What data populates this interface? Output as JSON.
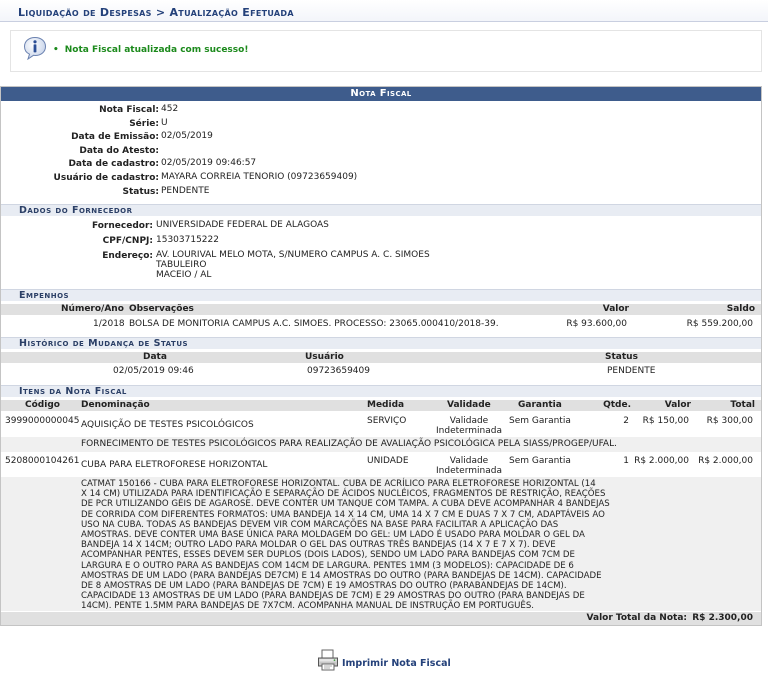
{
  "breadcrumb": "Liquidação de Despesas > Atualização Efetuada",
  "message": "Nota Fiscal atualizada com sucesso!",
  "panel_title": "Nota Fiscal",
  "nota": {
    "fields": [
      {
        "label": "Nota Fiscal:",
        "value": "452"
      },
      {
        "label": "Série:",
        "value": "U"
      },
      {
        "label": "Data de Emissão:",
        "value": "02/05/2019"
      },
      {
        "label": "Data do Atesto:",
        "value": ""
      },
      {
        "label": "Data de cadastro:",
        "value": "02/05/2019 09:46:57"
      },
      {
        "label": "Usuário de cadastro:",
        "value": "MAYARA CORREIA TENORIO (09723659409)"
      },
      {
        "label": "Status:",
        "value": "PENDENTE"
      }
    ]
  },
  "fornecedor": {
    "section": "Dados do Fornecedor",
    "fornecedor_label": "Fornecedor:",
    "fornecedor_value": "UNIVERSIDADE FEDERAL DE ALAGOAS",
    "cpf_label": "CPF/CNPJ:",
    "cpf_value": "15303715222",
    "endereco_label": "Endereço:",
    "endereco_lines": [
      "AV. LOURIVAL MELO MOTA, S/NUMERO CAMPUS A. C. SIMOES",
      "TABULEIRO",
      "MACEIO / AL"
    ]
  },
  "empenhos": {
    "section": "Empenhos",
    "headers": {
      "numero": "Número/Ano",
      "obs": "Observações",
      "valor": "Valor",
      "saldo": "Saldo"
    },
    "rows": [
      {
        "numero": "1/2018",
        "obs": "BOLSA DE MONITORIA CAMPUS A.C. SIMOES. PROCESSO: 23065.000410/2018-39.",
        "valor": "R$ 93.600,00",
        "saldo": "R$ 559.200,00"
      }
    ]
  },
  "historico": {
    "section": "Histórico de Mudança de Status",
    "headers": {
      "data": "Data",
      "usuario": "Usuário",
      "status": "Status"
    },
    "rows": [
      {
        "data": "02/05/2019 09:46",
        "usuario": "09723659409",
        "status": "PENDENTE"
      }
    ]
  },
  "itens": {
    "section": "Itens da Nota Fiscal",
    "headers": {
      "codigo": "Código",
      "denominacao": "Denominação",
      "medida": "Medida",
      "validade": "Validade",
      "garantia": "Garantia",
      "qtde": "Qtde.",
      "valor": "Valor",
      "total": "Total"
    },
    "rows": [
      {
        "codigo": "3999000000045",
        "denominacao": "AQUISIÇÃO DE TESTES PSICOLÓGICOS",
        "medida": "SERVIÇO",
        "validade": [
          "Validade",
          "Indeterminada"
        ],
        "garantia": "Sem Garantia",
        "qtde": "2",
        "valor": "R$ 150,00",
        "total": "R$ 300,00",
        "descricao": "FORNECIMENTO DE TESTES PSICOLÓGICOS PARA REALIZAÇÃO DE AVALIAÇÃO PSICOLÓGICA PELA SIASS/PROGEP/UFAL."
      },
      {
        "codigo": "5208000104261",
        "denominacao": "CUBA PARA ELETROFORESE HORIZONTAL",
        "medida": "UNIDADE",
        "validade": [
          "Validade",
          "Indeterminada"
        ],
        "garantia": "Sem Garantia",
        "qtde": "1",
        "valor": "R$ 2.000,00",
        "total": "R$ 2.000,00",
        "descricao_lines": [
          "CATMAT 150166 - CUBA PARA ELETROFORESE HORIZONTAL. CUBA DE ACRÍLICO PARA ELETROFORESE HORIZONTAL (14",
          "X 14 CM) UTILIZADA PARA IDENTIFICAÇÃO E SEPARAÇÃO DE ÁCIDOS NUCLÉICOS, FRAGMENTOS DE RESTRIÇÃO, REAÇÕES",
          "DE PCR UTILIZANDO GÉIS DE AGAROSE. DEVE CONTER UM TANQUE COM TAMPA. A CUBA DEVE ACOMPANHAR 4 BANDEJAS",
          "DE CORRIDA COM DIFERENTES FORMATOS: UMA BANDEJA 14 X 14 CM, UMA 14 X 7 CM E DUAS 7 X 7 CM, ADAPTÁVEIS AO",
          "USO NA CUBA. TODAS AS BANDEJAS DEVEM VIR COM MARCAÇÕES NA BASE PARA FACILITAR A APLICAÇÃO DAS",
          "AMOSTRAS. DEVE CONTER UMA BASE ÚNICA PARA MOLDAGEM DO GEL: UM LADO É USADO PARA MOLDAR O GEL DA",
          "BANDEJA 14 X 14CM; OUTRO LADO PARA MOLDAR O GEL DAS OUTRAS TRÊS BANDEJAS (14 X 7 E 7 X 7). DEVE",
          "ACOMPANHAR PENTES, ESSES DEVEM SER DUPLOS (DOIS LADOS), SENDO UM LADO PARA BANDEJAS COM 7CM DE",
          "LARGURA E O OUTRO PARA AS BANDEJAS COM 14CM DE LARGURA. PENTES 1MM (3 MODELOS): CAPACIDADE DE 6",
          "AMOSTRAS DE UM LADO (PARA BANDEJAS DE7CM) E 14 AMOSTRAS DO OUTRO (PARA BANDEJAS DE 14CM). CAPACIDADE",
          "DE 8 AMOSTRAS DE UM LADO (PARA BANDEJAS DE 7CM) E 19 AMOSTRAS DO OUTRO (PARABANDEJAS DE 14CM).",
          "CAPACIDADE 13 AMOSTRAS DE UM LADO (PARA BANDEJAS DE 7CM) E 29 AMOSTRAS DO OUTRO (PARA BANDEJAS DE",
          "14CM). PENTE 1.5MM PARA BANDEJAS DE 7X7CM. ACOMPANHA MANUAL DE INSTRUÇÃO EM PORTUGUÊS."
        ]
      }
    ],
    "total_label": "Valor Total da Nota:",
    "total_value": "R$ 2.300,00"
  },
  "print_label": "Imprimir Nota Fiscal",
  "colors": {
    "header_blue": "#3e5c8c",
    "success_green": "#1c8a1c",
    "link_blue": "#24417a"
  }
}
